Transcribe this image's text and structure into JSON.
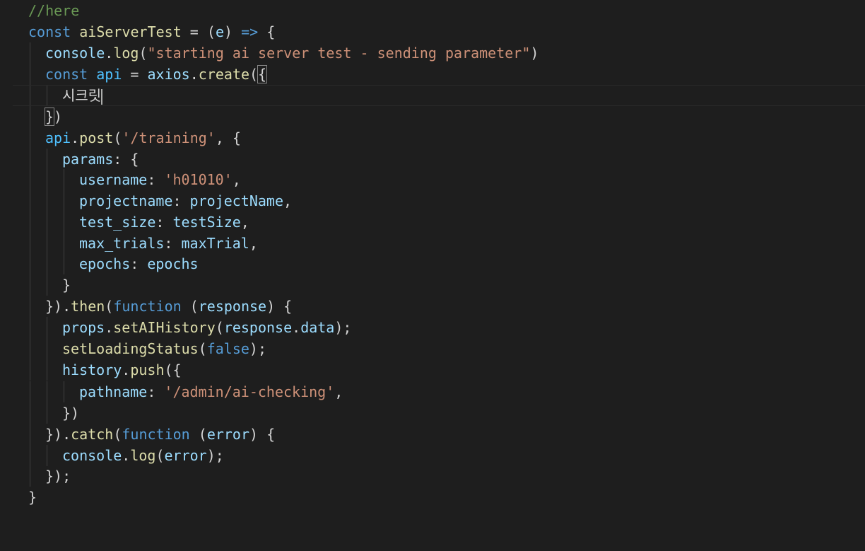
{
  "code": {
    "l1": "//here",
    "l2_kw": "const",
    "l2_name": "aiServerTest",
    "l2_eq": " = (",
    "l2_param": "e",
    "l2_arrow_open": ") ",
    "l2_arrow": "=>",
    "l2_brace": " {",
    "l3_obj": "console",
    "l3_dot": ".",
    "l3_fn": "log",
    "l3_open": "(",
    "l3_str": "\"starting ai server test - sending parameter\"",
    "l3_close": ")",
    "l4_kw": "const",
    "l4_var": "api",
    "l4_eq": " = ",
    "l4_obj": "axios",
    "l4_dot": ".",
    "l4_fn": "create",
    "l4_paren": "(",
    "l4_brace": "{",
    "l5_text": "시크릿",
    "l6_brace": "}",
    "l6_paren": ")",
    "l7_obj": "api",
    "l7_dot": ".",
    "l7_fn": "post",
    "l7_open": "(",
    "l7_str": "'/training'",
    "l7_rest": ", {",
    "l8_prop": "params",
    "l8_rest": ": {",
    "l9_prop": "username",
    "l9_colon": ": ",
    "l9_str": "'h01010'",
    "l9_comma": ",",
    "l10_prop": "projectname",
    "l10_colon": ": ",
    "l10_val": "projectName",
    "l10_comma": ",",
    "l11_prop": "test_size",
    "l11_colon": ": ",
    "l11_val": "testSize",
    "l11_comma": ",",
    "l12_prop": "max_trials",
    "l12_colon": ": ",
    "l12_val": "maxTrial",
    "l12_comma": ",",
    "l13_prop": "epochs",
    "l13_colon": ": ",
    "l13_val": "epochs",
    "l14_brace": "}",
    "l15_close": "}).",
    "l15_fn": "then",
    "l15_open": "(",
    "l15_kw": "function",
    "l15_sp": " (",
    "l15_param": "response",
    "l15_rest": ") {",
    "l16_obj": "props",
    "l16_dot": ".",
    "l16_fn": "setAIHistory",
    "l16_open": "(",
    "l16_arg": "response",
    "l16_dot2": ".",
    "l16_prop": "data",
    "l16_close": ");",
    "l17_fn": "setLoadingStatus",
    "l17_open": "(",
    "l17_bool": "false",
    "l17_close": ");",
    "l18_obj": "history",
    "l18_dot": ".",
    "l18_fn": "push",
    "l18_rest": "({",
    "l19_prop": "pathname",
    "l19_colon": ": ",
    "l19_str": "'/admin/ai-checking'",
    "l19_comma": ",",
    "l20_text": "})",
    "l21_close": "}).",
    "l21_fn": "catch",
    "l21_open": "(",
    "l21_kw": "function",
    "l21_sp": " (",
    "l21_param": "error",
    "l21_rest": ") {",
    "l22_obj": "console",
    "l22_dot": ".",
    "l22_fn": "log",
    "l22_open": "(",
    "l22_arg": "error",
    "l22_close": ");",
    "l23_text": "});",
    "l24_text": "}"
  },
  "colors": {
    "background": "#1e1e1e",
    "keyword": "#569cd6",
    "function": "#dcdcaa",
    "variable": "#9cdcfe",
    "string": "#ce9178",
    "comment": "#6a9955",
    "constant": "#4fc1ff"
  }
}
